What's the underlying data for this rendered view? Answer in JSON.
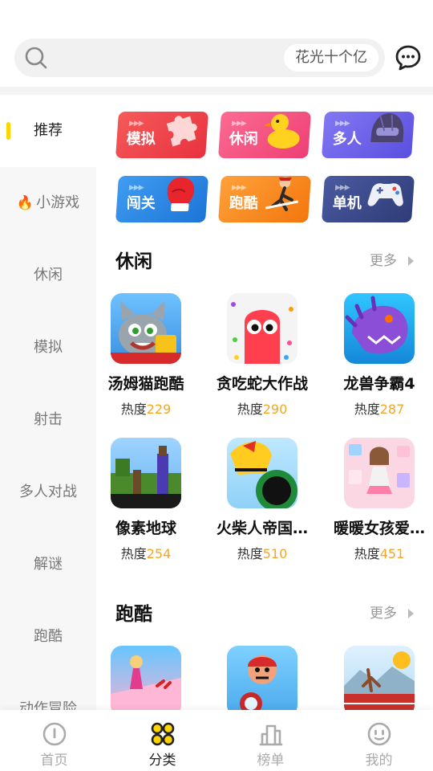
{
  "search": {
    "hint": "花光十个亿"
  },
  "sidebar": {
    "items": [
      {
        "label": "推荐",
        "active": true
      },
      {
        "label": "小游戏",
        "hot": true
      },
      {
        "label": "休闲"
      },
      {
        "label": "模拟"
      },
      {
        "label": "射击"
      },
      {
        "label": "多人对战"
      },
      {
        "label": "解谜"
      },
      {
        "label": "跑酷"
      },
      {
        "label": "动作冒险"
      }
    ]
  },
  "categories": [
    {
      "label": "模拟",
      "color": "#f0464c",
      "icon": "puzzle-icon"
    },
    {
      "label": "休闲",
      "color": "#f2517e",
      "icon": "duck-icon"
    },
    {
      "label": "多人",
      "color": "#6b62e8",
      "icon": "helmet-icon"
    },
    {
      "label": "闯关",
      "color": "#2f8de6",
      "icon": "boxing-glove-icon"
    },
    {
      "label": "跑酷",
      "color": "#f78a1d",
      "icon": "runner-icon"
    },
    {
      "label": "单机",
      "color": "#3a4a8c",
      "icon": "gamepad-icon"
    }
  ],
  "sections": [
    {
      "title": "休闲",
      "more": "更多",
      "games": [
        {
          "name": "汤姆猫跑酷",
          "heat_label": "热度",
          "heat": "229"
        },
        {
          "name": "贪吃蛇大作战",
          "heat_label": "热度",
          "heat": "290"
        },
        {
          "name": "龙兽争霸4",
          "heat_label": "热度",
          "heat": "287"
        },
        {
          "name": "像素地球",
          "heat_label": "热度",
          "heat": "254"
        },
        {
          "name": "火柴人帝国…",
          "heat_label": "热度",
          "heat": "510"
        },
        {
          "name": "暖暖女孩爱…",
          "heat_label": "热度",
          "heat": "451"
        }
      ]
    },
    {
      "title": "跑酷",
      "more": "更多",
      "games": []
    }
  ],
  "nav": {
    "items": [
      {
        "label": "首页"
      },
      {
        "label": "分类",
        "active": true
      },
      {
        "label": "榜单"
      },
      {
        "label": "我的"
      }
    ]
  }
}
